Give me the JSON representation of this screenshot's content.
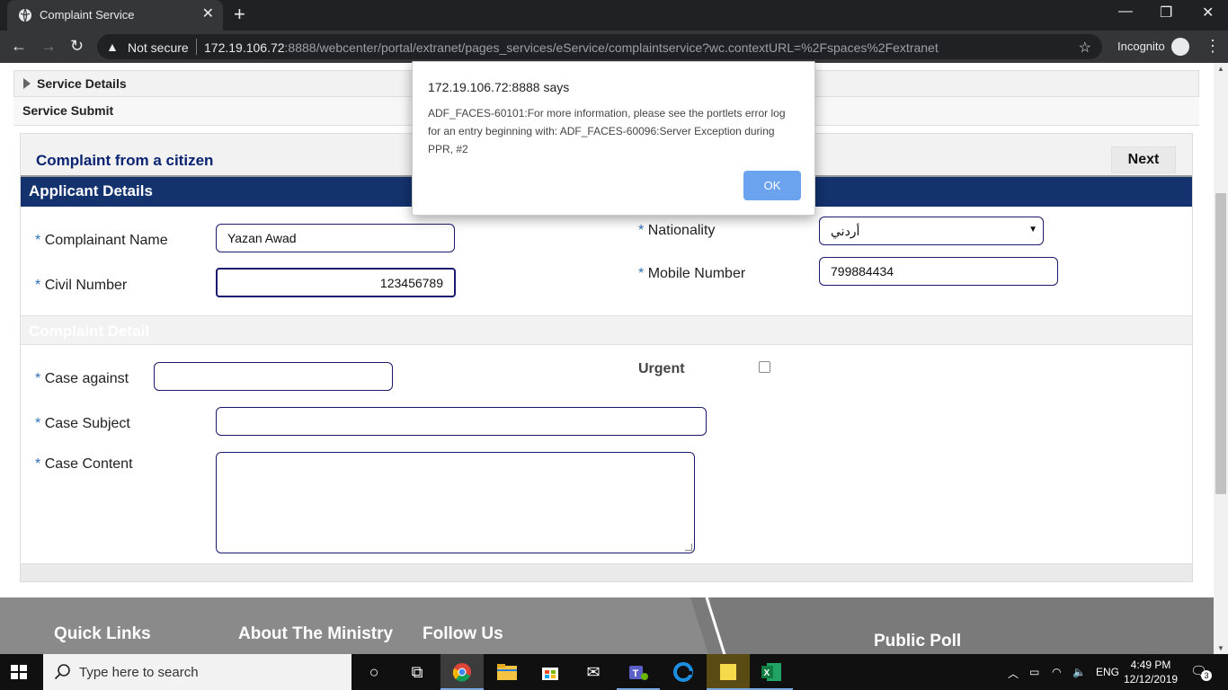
{
  "browser": {
    "tab_title": "Complaint Service",
    "security_label": "Not secure",
    "url_host": "172.19.106.72",
    "url_rest": ":8888/webcenter/portal/extranet/pages_services/eService/complaintservice?wc.contextURL=%2Fspaces%2Fextranet",
    "incognito_label": "Incognito"
  },
  "page": {
    "service_details": "Service Details",
    "service_submit": "Service Submit",
    "form_title": "Complaint from a citizen",
    "next_label": "Next",
    "applicant_section": "Applicant Details",
    "complaint_section": "Complaint Detail",
    "required_mark": "*",
    "fields": {
      "complainant_name": {
        "label": "Complainant Name",
        "value": "Yazan Awad"
      },
      "civil_number": {
        "label": "Civil Number",
        "value": "123456789"
      },
      "nationality": {
        "label": "Nationality",
        "value": "أردني"
      },
      "mobile_number": {
        "label": "Mobile Number",
        "value": "799884434"
      },
      "case_against": {
        "label": "Case against",
        "value": ""
      },
      "case_subject": {
        "label": "Case Subject",
        "value": ""
      },
      "case_content": {
        "label": "Case Content",
        "value": ""
      },
      "urgent": {
        "label": "Urgent",
        "checked": false
      }
    }
  },
  "footer": {
    "quick_links": "Quick Links",
    "about": "About The Ministry",
    "follow": "Follow Us",
    "poll": "Public Poll"
  },
  "dialog": {
    "title": "172.19.106.72:8888 says",
    "message": "ADF_FACES-60101:For more information, please see the portlets error log for an entry beginning with: ADF_FACES-60096:Server Exception during PPR, #2",
    "ok_label": "OK"
  },
  "taskbar": {
    "search_placeholder": "Type here to search",
    "language": "ENG",
    "time": "4:49 PM",
    "date": "12/12/2019",
    "notification_count": "3"
  },
  "colors": {
    "section_bar": "#14326d",
    "form_title": "#0a2472",
    "ok_button": "#6ba3ee",
    "required": "#2a6fb8"
  }
}
